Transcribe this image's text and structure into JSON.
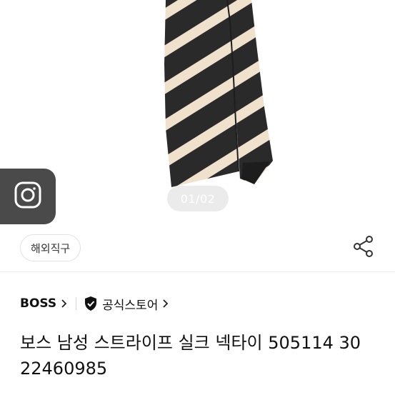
{
  "gallery": {
    "page_indicator": "01/02"
  },
  "badge": {
    "label": "해외직구"
  },
  "brand": {
    "name": "BOSS",
    "store_label": "공식스토어"
  },
  "product": {
    "title": "보스 남성 스트라이프 실크 넥타이 505114 30 22460985"
  },
  "icons": {
    "camera": "camera-icon",
    "share": "share-icon",
    "chevron": "chevron-right-icon",
    "verified": "verified-shield-icon"
  },
  "colors": {
    "tie_dark": "#2b2a2b",
    "tie_stripe": "#efe1cc",
    "camera_bg": "#4a4a4a"
  }
}
